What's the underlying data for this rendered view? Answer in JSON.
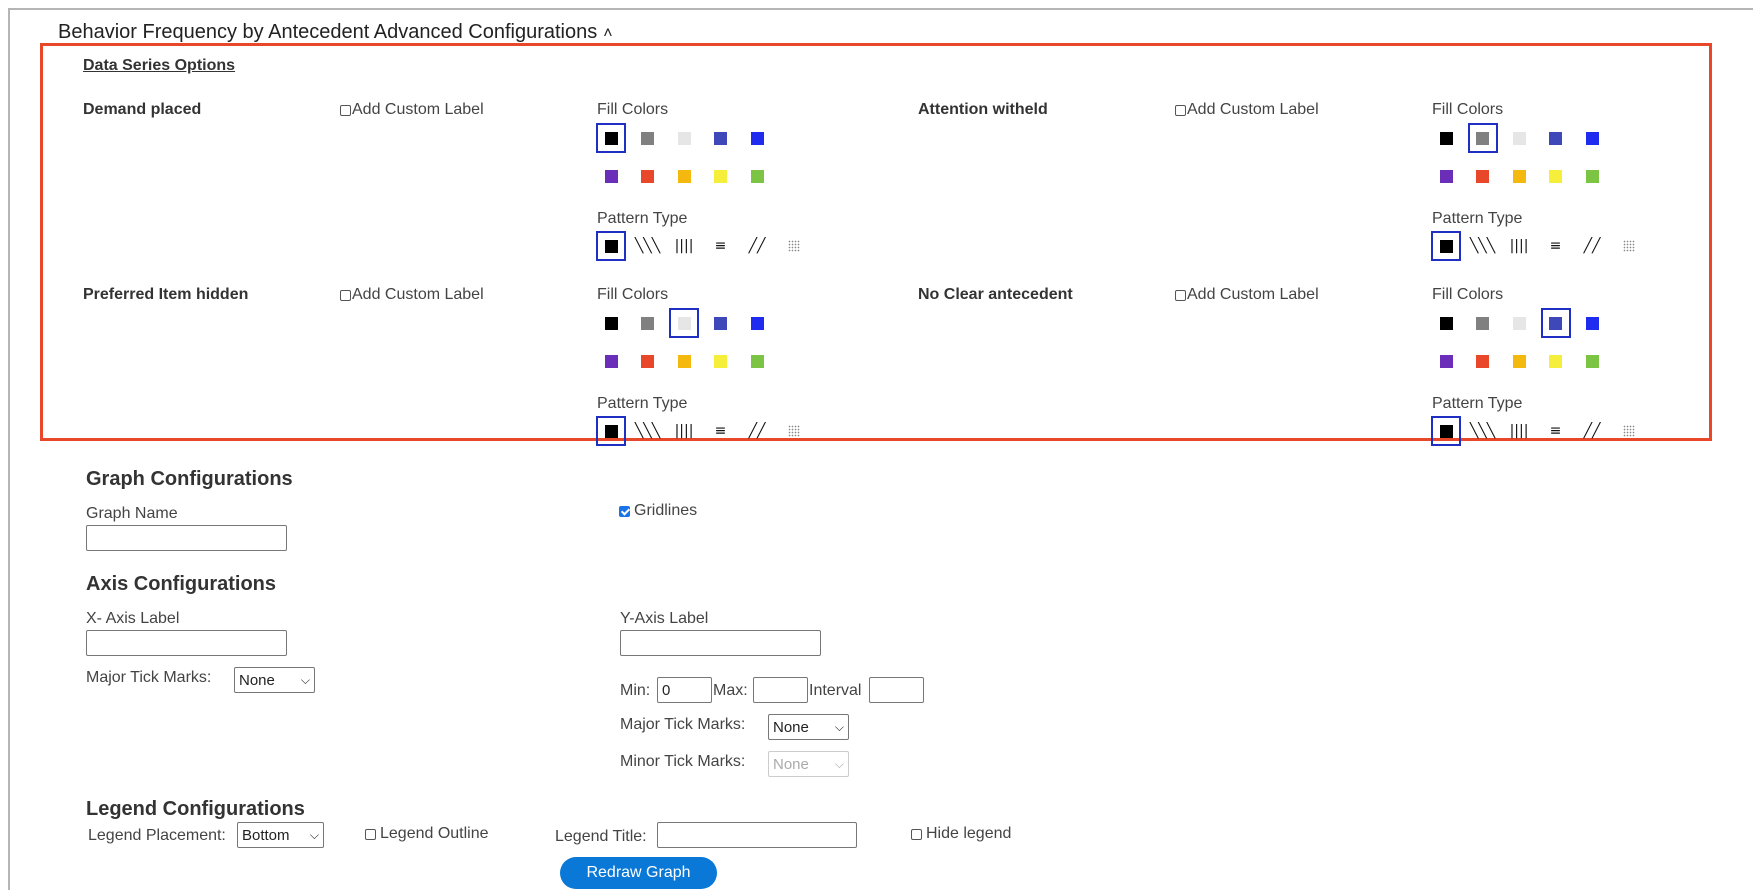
{
  "section_title": "Behavior Frequency by Antecedent Advanced Configurations",
  "data_series_options": {
    "heading": "Data Series Options",
    "fill_colors_label": "Fill Colors",
    "pattern_type_label": "Pattern Type",
    "custom_label_text": "Add Custom Label",
    "palette": [
      "#000000",
      "#808080",
      "#e6e6e6",
      "#3f48b8",
      "#1f2bef",
      "#6a2eb8",
      "#e8472a",
      "#f5b80e",
      "#f5ef3b",
      "#7cc443"
    ],
    "patterns": [
      "solid",
      "diagonal-right",
      "vertical",
      "horizontal",
      "diagonal-left",
      "dots"
    ],
    "series": [
      {
        "name": "Demand placed",
        "selected_color": 0,
        "selected_pattern": 0
      },
      {
        "name": "Attention witheld",
        "selected_color": 1,
        "selected_pattern": 0
      },
      {
        "name": "Preferred Item hidden",
        "selected_color": 2,
        "selected_pattern": 0
      },
      {
        "name": "No Clear antecedent",
        "selected_color": 3,
        "selected_pattern": 0
      }
    ]
  },
  "graph_config": {
    "heading": "Graph Configurations",
    "graph_name_label": "Graph Name",
    "graph_name_value": "",
    "gridlines_label": "Gridlines",
    "gridlines_checked": true
  },
  "axis_config": {
    "heading": "Axis Configurations",
    "x_label": "X- Axis Label",
    "x_value": "",
    "x_major_tick_label": "Major Tick Marks:",
    "x_major_tick_value": "None",
    "y_label": "Y-Axis Label",
    "y_value": "",
    "min_label": "Min:",
    "min_value": "0",
    "max_label": "Max:",
    "max_value": "",
    "interval_label": "Interval",
    "interval_value": "",
    "y_major_tick_label": "Major Tick Marks:",
    "y_major_tick_value": "None",
    "y_minor_tick_label": "Minor Tick Marks:",
    "y_minor_tick_value": "None"
  },
  "legend_config": {
    "heading": "Legend Configurations",
    "placement_label": "Legend Placement:",
    "placement_value": "Bottom",
    "outline_label": "Legend Outline",
    "title_label": "Legend Title:",
    "title_value": "",
    "hide_label": "Hide legend"
  },
  "redraw_button": "Redraw Graph"
}
